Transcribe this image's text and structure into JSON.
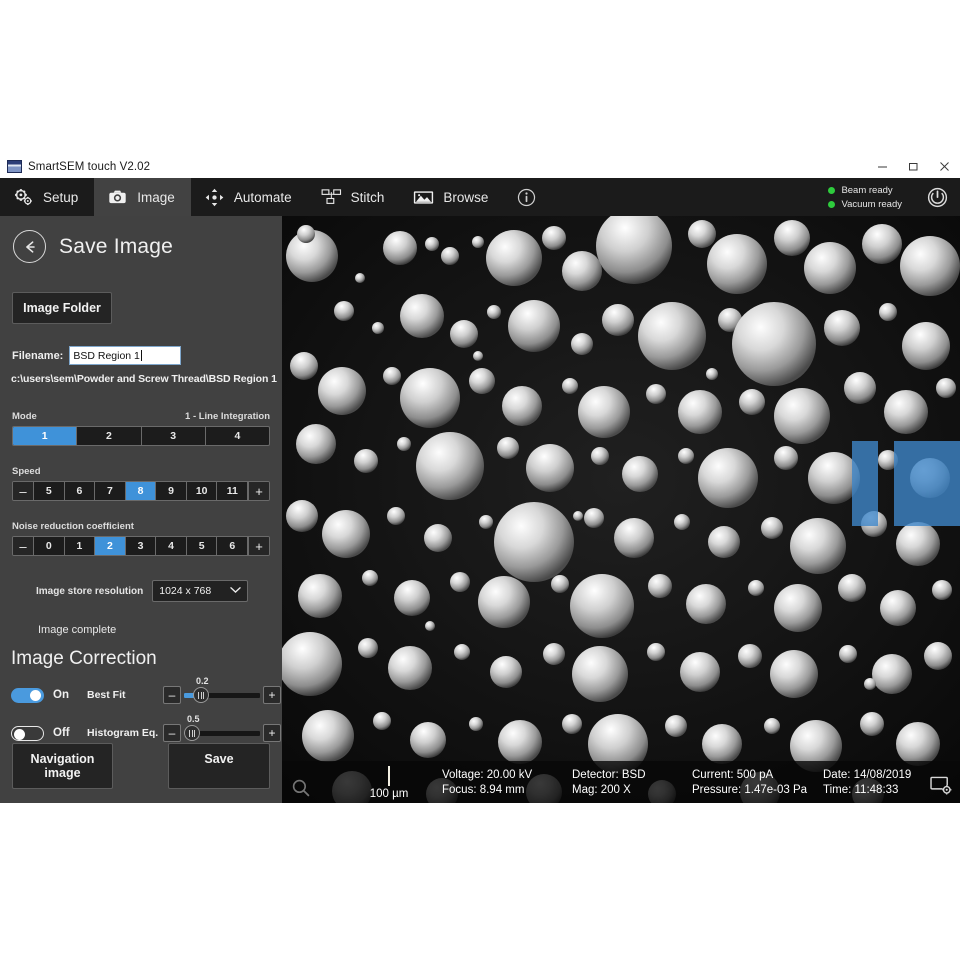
{
  "window": {
    "title": "SmartSEM touch V2.02",
    "minimize": "–",
    "maximize": "▭",
    "close": "✕"
  },
  "tabs": [
    {
      "label": "Setup",
      "icon": "gears-icon",
      "active": false
    },
    {
      "label": "Image",
      "icon": "camera-icon",
      "active": true
    },
    {
      "label": "Automate",
      "icon": "move-arrows-icon",
      "active": false
    },
    {
      "label": "Stitch",
      "icon": "stitch-tiles-icon",
      "active": false
    },
    {
      "label": "Browse",
      "icon": "picture-icon",
      "active": false
    },
    {
      "label": "",
      "icon": "info-icon",
      "active": false
    }
  ],
  "status": {
    "beam": "Beam ready",
    "vacuum": "Vacuum ready",
    "indicator_color": "#2ecc3d",
    "power_icon": "power-icon"
  },
  "panel": {
    "back_icon": "back-arrow-icon",
    "title": "Save Image",
    "image_folder_button": "Image Folder",
    "filename_label": "Filename:",
    "filename_value": "BSD Region 1",
    "path": "c:\\users\\sem\\Powder and Screw Thread\\BSD Region 1",
    "mode": {
      "label": "Mode",
      "value_text": "1 - Line Integration",
      "options": [
        "1",
        "2",
        "3",
        "4"
      ],
      "selected": "1"
    },
    "speed": {
      "label": "Speed",
      "minus": "–",
      "plus": "+",
      "options": [
        "5",
        "6",
        "7",
        "8",
        "9",
        "10",
        "11"
      ],
      "selected": "8"
    },
    "noise": {
      "label": "Noise reduction coefficient",
      "minus": "–",
      "plus": "+",
      "options": [
        "0",
        "1",
        "2",
        "3",
        "4",
        "5",
        "6"
      ],
      "selected": "2"
    },
    "resolution": {
      "label": "Image store resolution",
      "value": "1024 x 768",
      "caret_icon": "chevron-down-icon"
    },
    "image_status": "Image complete",
    "correction_title": "Image Correction",
    "corrections": [
      {
        "state": "On",
        "name": "Best Fit",
        "value": "0.2",
        "minus": "–",
        "plus": "+",
        "toggle_on": true,
        "fill_percent": 9
      },
      {
        "state": "Off",
        "name": "Histogram Eq.",
        "value": "0.5",
        "minus": "–",
        "plus": "+",
        "toggle_on": false,
        "fill_percent": 0
      }
    ],
    "navigation_button": "Navigation image",
    "save_button": "Save"
  },
  "image_view": {
    "scalebar": "100 µm",
    "magnifier_icon": "magnifier-icon",
    "screen_settings_icon": "screen-settings-icon",
    "databar": {
      "voltage": "Voltage: 20.00 kV",
      "focus": "Focus: 8.94 mm",
      "detector": "Detector: BSD",
      "mag": "Mag: 200 X",
      "current": "Current: 500 pA",
      "pressure": "Pressure: 1.47e-03 Pa",
      "date": "Date: 14/08/2019",
      "time": "Time: 11:48:33"
    }
  },
  "colors": {
    "accent": "#3f92d9",
    "panel": "#414141",
    "tabbar": "#1b1b1b",
    "status_green": "#2ecc3d"
  }
}
